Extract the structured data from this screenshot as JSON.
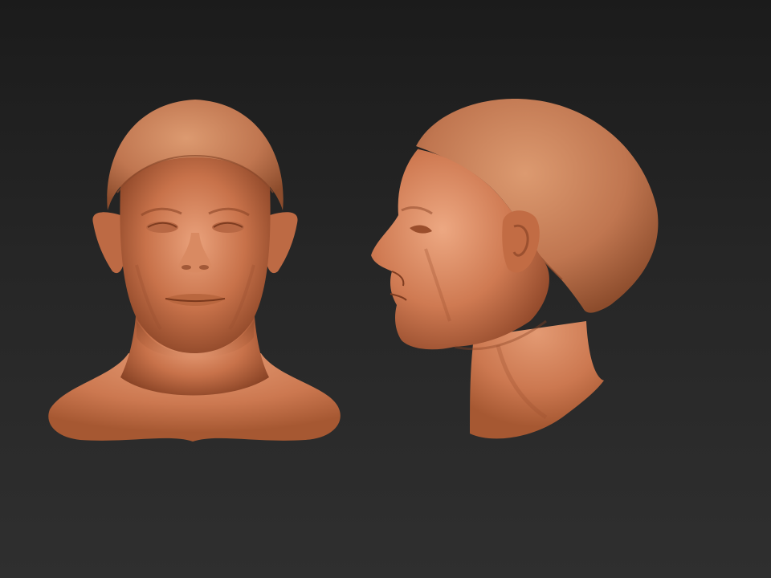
{
  "scene": {
    "background_top": "#1b1b1b",
    "background_bottom": "#2f2f2f",
    "skin_light": "#e8a07a",
    "skin_mid": "#c8724a",
    "skin_dark": "#8e4628",
    "cap_color": "#c47a52",
    "views": [
      {
        "id": "front",
        "icon": "sculpted-head-front-view-icon"
      },
      {
        "id": "side",
        "icon": "sculpted-head-side-view-icon"
      }
    ]
  }
}
